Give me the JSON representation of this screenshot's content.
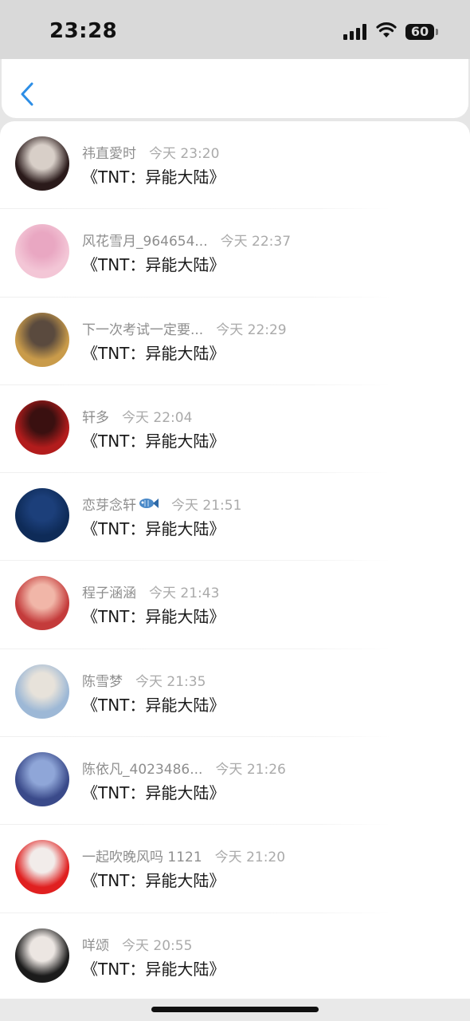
{
  "status_bar": {
    "time": "23:28",
    "battery": "60"
  },
  "nav": {
    "back_icon": "chevron-left-icon"
  },
  "items": [
    {
      "name": "祎直愛时",
      "time": "今天 23:20",
      "title": "《TNT：异能大陆》",
      "avatar_colors": [
        "#2a1a1a",
        "#d8cfc8"
      ]
    },
    {
      "name": "风花雪月_964654...",
      "time": "今天 22:37",
      "title": "《TNT：异能大陆》",
      "avatar_colors": [
        "#f3c6d6",
        "#e9a7c2"
      ]
    },
    {
      "name": "下一次考试一定要...",
      "time": "今天 22:29",
      "title": "《TNT：异能大陆》",
      "avatar_colors": [
        "#c99b4a",
        "#5a4a3e"
      ]
    },
    {
      "name": "轩多",
      "time": "今天 22:04",
      "title": "《TNT：异能大陆》",
      "avatar_colors": [
        "#b21c1c",
        "#3a1010"
      ]
    },
    {
      "name": "恋芽念轩",
      "badge_icon": "fish-icon",
      "time": "今天 21:51",
      "title": "《TNT：异能大陆》",
      "avatar_colors": [
        "#0e2b58",
        "#1c3f7a"
      ]
    },
    {
      "name": "程子涵涵",
      "time": "今天 21:43",
      "title": "《TNT：异能大陆》",
      "avatar_colors": [
        "#c43b3b",
        "#f1b6a8"
      ]
    },
    {
      "name": "陈雪梦",
      "time": "今天 21:35",
      "title": "《TNT：异能大陆》",
      "avatar_colors": [
        "#9db8d6",
        "#e7e2da"
      ]
    },
    {
      "name": "陈依凡_4023486...",
      "time": "今天 21:26",
      "title": "《TNT：异能大陆》",
      "avatar_colors": [
        "#3a4a8a",
        "#8fa6d8"
      ]
    },
    {
      "name": "一起吹晚风吗 1121",
      "time": "今天 21:20",
      "title": "《TNT：异能大陆》",
      "avatar_colors": [
        "#e02020",
        "#f2ecea"
      ]
    },
    {
      "name": "咩颂",
      "time": "今天 20:55",
      "title": "《TNT：异能大陆》",
      "avatar_colors": [
        "#1b1b1b",
        "#ece6e2"
      ]
    }
  ]
}
